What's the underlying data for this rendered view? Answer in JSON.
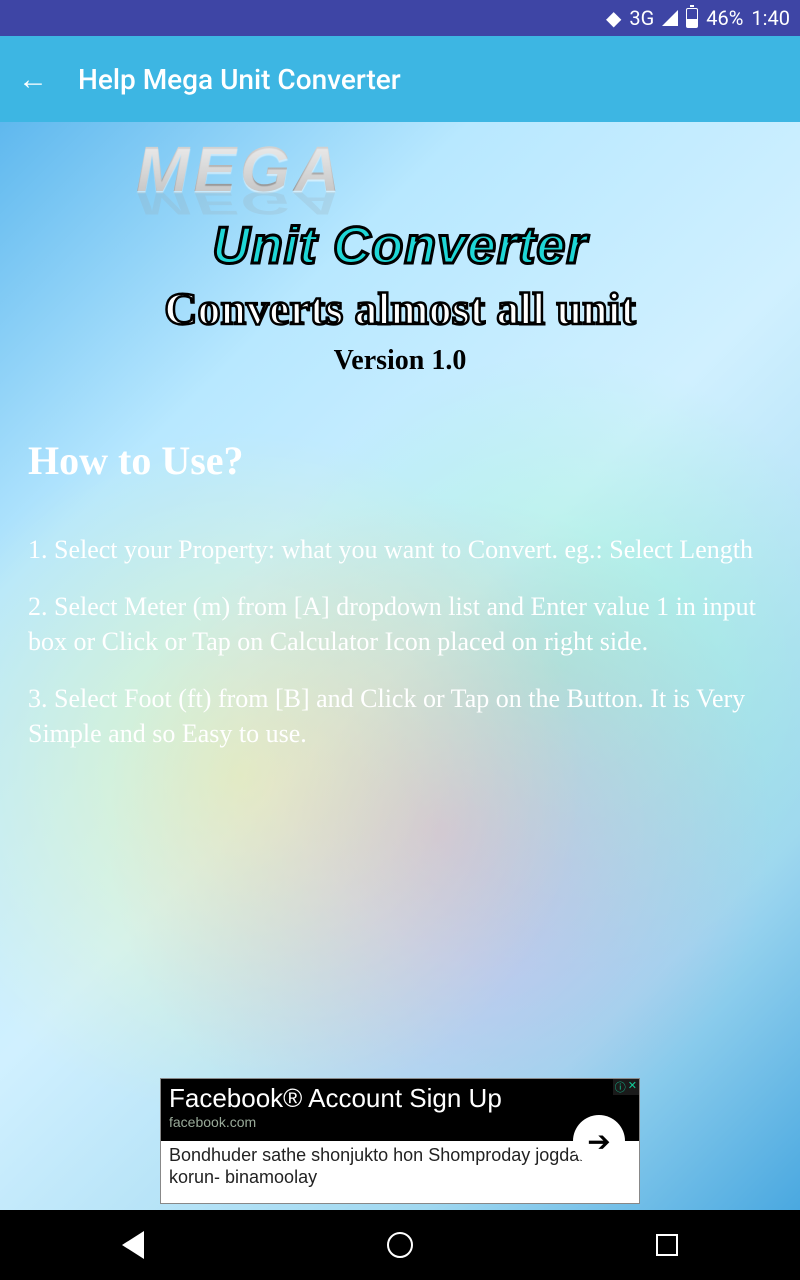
{
  "status": {
    "network": "3G",
    "battery": "46%",
    "time": "1:40"
  },
  "appbar": {
    "title": "Help Mega Unit Converter"
  },
  "logo": {
    "brand": "MEGA",
    "subtitle": "Unit Converter",
    "tagline": "Converts almost all unit",
    "version": "Version 1.0"
  },
  "help": {
    "heading": "How to Use?",
    "steps": [
      "1. Select your Property: what you want to Convert. eg.: Select Length",
      "2. Select Meter (m) from [A] dropdown list and Enter value 1 in input box or Click or Tap on Calculator Icon placed on right side.",
      "3. Select Foot (ft) from [B] and Click or Tap on the Button. It is Very Simple and so Easy to use."
    ]
  },
  "ad": {
    "title": "Facebook® Account Sign Up",
    "domain": "facebook.com",
    "body": "Bondhuder sathe shonjukto hon Shomproday jogdan korun- binamoolay",
    "info": "ⓘ",
    "close": "✕"
  }
}
